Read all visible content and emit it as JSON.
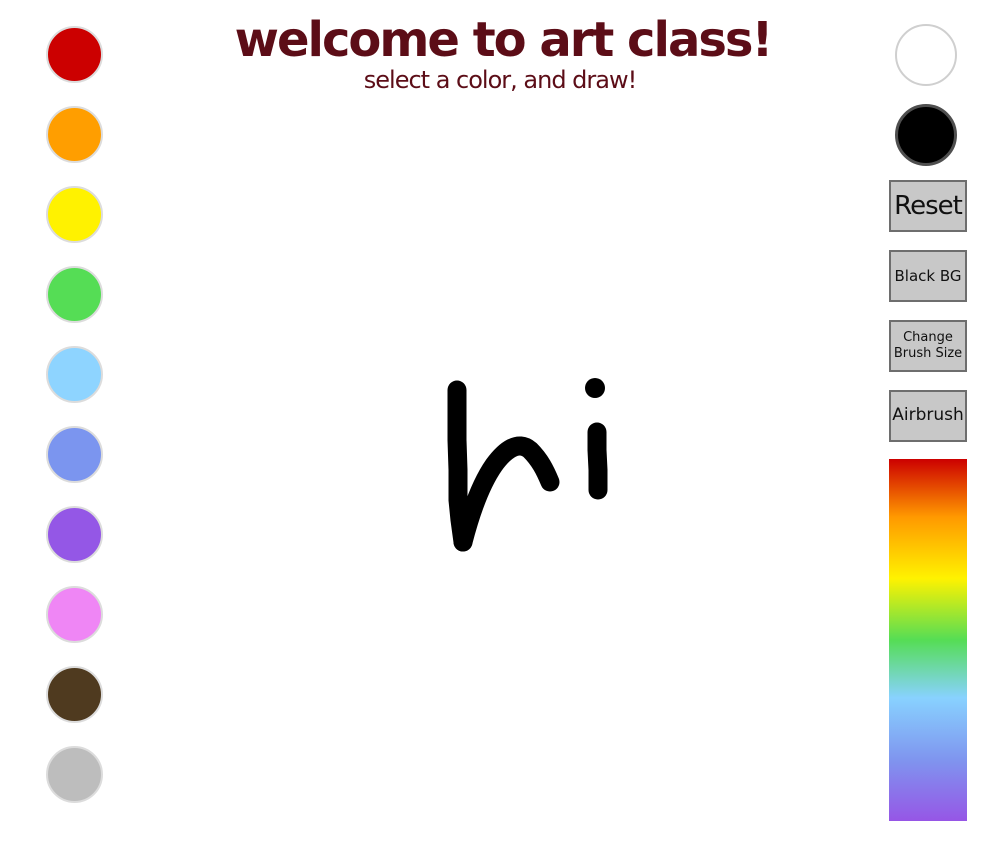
{
  "header": {
    "title": "welcome to art class!",
    "subtitle": "select a color, and draw!"
  },
  "palette": {
    "left_colors": [
      "#cc0000",
      "#ff9e00",
      "#fff200",
      "#55dd55",
      "#8ed4ff",
      "#7b95ef",
      "#9457e6",
      "#ef86f5",
      "#4f3a1f",
      "#bdbdbd"
    ],
    "right_colors": [
      "#ffffff",
      "#000000"
    ]
  },
  "tools": {
    "reset_label": "Reset",
    "black_bg_label": "Black BG",
    "change_brush_line1": "Change",
    "change_brush_line2": "Brush Size",
    "airbrush_label": "Airbrush"
  },
  "drawing": {
    "brush_color": "#000000",
    "text": "hi"
  }
}
